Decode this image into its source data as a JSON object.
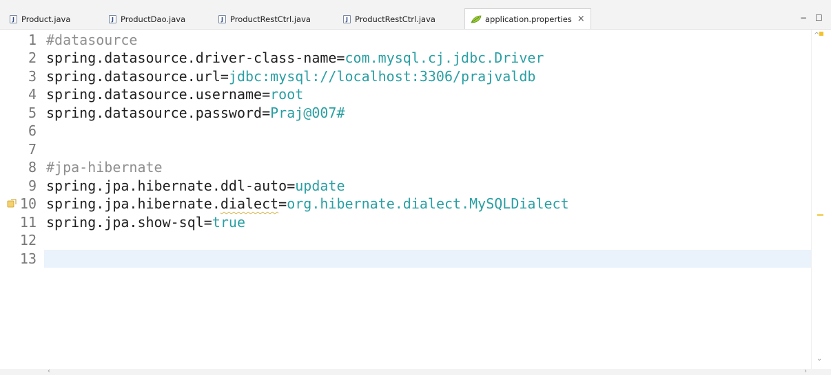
{
  "tabs": [
    {
      "label": "Product.java",
      "icon": "java-file-icon",
      "active": false
    },
    {
      "label": "ProductDao.java",
      "icon": "java-file-icon",
      "active": false
    },
    {
      "label": "ProductRestCtrl.java",
      "icon": "java-file-icon",
      "active": false
    },
    {
      "label": "ProductRestCtrl.java",
      "icon": "java-file-icon",
      "active": false
    },
    {
      "label": "application.properties",
      "icon": "properties-leaf-icon",
      "active": true,
      "close": "×"
    }
  ],
  "window_controls": {
    "minimize": "−",
    "maximize": "☐"
  },
  "editor": {
    "lines": [
      {
        "num": "1",
        "parts": [
          {
            "t": "#datasource",
            "c": "cmt"
          }
        ]
      },
      {
        "num": "2",
        "parts": [
          {
            "t": "spring.datasource.driver-class-name=",
            "c": "key"
          },
          {
            "t": "com.mysql.cj.jdbc.Driver",
            "c": "val"
          }
        ]
      },
      {
        "num": "3",
        "parts": [
          {
            "t": "spring.datasource.url=",
            "c": "key"
          },
          {
            "t": "jdbc:mysql://localhost:3306/prajvaldb",
            "c": "val"
          }
        ]
      },
      {
        "num": "4",
        "parts": [
          {
            "t": "spring.datasource.username=",
            "c": "key"
          },
          {
            "t": "root",
            "c": "val"
          }
        ]
      },
      {
        "num": "5",
        "parts": [
          {
            "t": "spring.datasource.password=",
            "c": "key"
          },
          {
            "t": "Praj@007#",
            "c": "val"
          }
        ]
      },
      {
        "num": "6",
        "parts": []
      },
      {
        "num": "7",
        "parts": []
      },
      {
        "num": "8",
        "parts": [
          {
            "t": "#jpa-hibernate",
            "c": "cmt"
          }
        ]
      },
      {
        "num": "9",
        "parts": [
          {
            "t": "spring.jpa.hibernate.ddl-auto=",
            "c": "key"
          },
          {
            "t": "update",
            "c": "val"
          }
        ]
      },
      {
        "num": "10",
        "warning": true,
        "parts": [
          {
            "t": "spring.jpa.hibernate.",
            "c": "key"
          },
          {
            "t": "dialect",
            "c": "key squiggle"
          },
          {
            "t": "=",
            "c": "key"
          },
          {
            "t": "org.hibernate.dialect.MySQLDialect",
            "c": "val"
          }
        ]
      },
      {
        "num": "11",
        "parts": [
          {
            "t": "spring.jpa.show-sql=",
            "c": "key"
          },
          {
            "t": "true",
            "c": "val"
          }
        ]
      },
      {
        "num": "12",
        "parts": []
      },
      {
        "num": "13",
        "parts": [],
        "current": true
      }
    ]
  },
  "colors": {
    "key": "#1f1f1f",
    "value": "#2a9fa3",
    "comment": "#8f8f8f",
    "current_line": "#eaf2fb"
  }
}
